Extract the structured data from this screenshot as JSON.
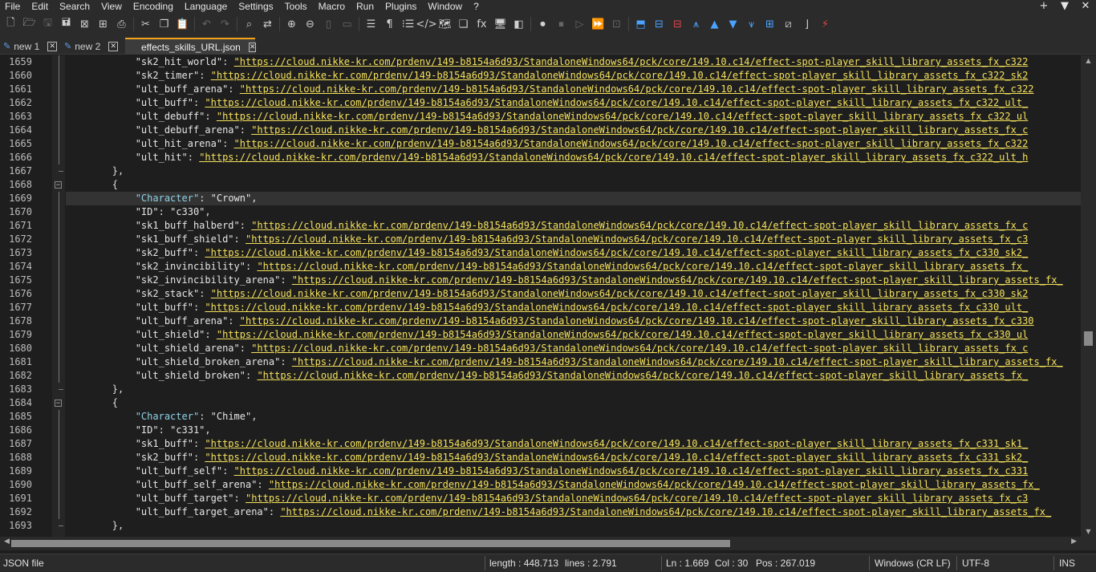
{
  "menu": {
    "items": [
      "File",
      "Edit",
      "Search",
      "View",
      "Encoding",
      "Language",
      "Settings",
      "Tools",
      "Macro",
      "Run",
      "Plugins",
      "Window",
      "?"
    ],
    "right": [
      "+",
      "▼",
      "✕"
    ]
  },
  "toolbar": {
    "icons": [
      {
        "name": "new-file-icon",
        "glyph": "🗋"
      },
      {
        "name": "open-file-icon",
        "glyph": "🗁"
      },
      {
        "name": "save-icon",
        "glyph": "🖫",
        "dim": true
      },
      {
        "name": "save-all-icon",
        "glyph": "🖬"
      },
      {
        "name": "close-icon",
        "glyph": "⊠"
      },
      {
        "name": "close-all-icon",
        "glyph": "⊞"
      },
      {
        "name": "print-icon",
        "glyph": "⎙"
      },
      {
        "name": "sep"
      },
      {
        "name": "cut-icon",
        "glyph": "✂"
      },
      {
        "name": "copy-icon",
        "glyph": "❐"
      },
      {
        "name": "paste-icon",
        "glyph": "📋"
      },
      {
        "name": "sep"
      },
      {
        "name": "undo-icon",
        "glyph": "↶",
        "dim": true
      },
      {
        "name": "redo-icon",
        "glyph": "↷",
        "dim": true
      },
      {
        "name": "sep"
      },
      {
        "name": "find-icon",
        "glyph": "⌕"
      },
      {
        "name": "replace-icon",
        "glyph": "⇄"
      },
      {
        "name": "sep"
      },
      {
        "name": "zoom-in-icon",
        "glyph": "⊕"
      },
      {
        "name": "zoom-out-icon",
        "glyph": "⊖"
      },
      {
        "name": "sync-vertical-icon",
        "glyph": "▯",
        "dim": true
      },
      {
        "name": "sync-horizontal-icon",
        "glyph": "▭",
        "dim": true
      },
      {
        "name": "sep"
      },
      {
        "name": "word-wrap-icon",
        "glyph": "☰"
      },
      {
        "name": "show-all-chars-icon",
        "glyph": "¶"
      },
      {
        "name": "indent-guide-icon",
        "glyph": "⁝☰"
      },
      {
        "name": "xml-icon",
        "glyph": "</>"
      },
      {
        "name": "doc-map-icon",
        "glyph": "🗺"
      },
      {
        "name": "doc-list-icon",
        "glyph": "❏"
      },
      {
        "name": "function-list-icon",
        "glyph": "fx"
      },
      {
        "name": "folder-workspace-icon",
        "glyph": "🖥"
      },
      {
        "name": "monitoring-icon",
        "glyph": "◧"
      },
      {
        "name": "sep"
      },
      {
        "name": "record-macro-icon",
        "glyph": "⏺"
      },
      {
        "name": "stop-macro-icon",
        "glyph": "⏹",
        "dim": true
      },
      {
        "name": "play-macro-icon",
        "glyph": "▷",
        "dim": true
      },
      {
        "name": "run-macro-multiple-icon",
        "glyph": "⏩"
      },
      {
        "name": "save-macro-icon",
        "glyph": "⊡",
        "dim": true
      },
      {
        "name": "sep"
      },
      {
        "name": "plugin-a-icon",
        "glyph": "⬒",
        "blue": true
      },
      {
        "name": "plugin-b-icon",
        "glyph": "⊟",
        "blue": true
      },
      {
        "name": "plugin-c-icon",
        "glyph": "⊟",
        "red": true
      },
      {
        "name": "plugin-d-icon",
        "glyph": "⩚",
        "blue": true
      },
      {
        "name": "move-up-icon",
        "glyph": "▲",
        "blue": true
      },
      {
        "name": "move-down-icon",
        "glyph": "▼",
        "blue": true
      },
      {
        "name": "plugin-e-icon",
        "glyph": "⩛",
        "blue": true
      },
      {
        "name": "plugin-f-icon",
        "glyph": "⊞",
        "blue": true
      },
      {
        "name": "plugin-g-icon",
        "glyph": "⧄"
      },
      {
        "name": "plugin-h-icon",
        "glyph": "⌋"
      },
      {
        "name": "plugin-i-icon",
        "glyph": "⚡",
        "red": true
      }
    ]
  },
  "tabs": [
    {
      "label": "new 1",
      "close": "✕",
      "active": false
    },
    {
      "label": "new 2",
      "close": "✕",
      "active": false
    },
    {
      "label": "effects_skills_URL.json",
      "close": "✕",
      "active": true
    }
  ],
  "url_prefix": "https://cloud.nikke-kr.com/prdenv/149-b8154a6d93/StandaloneWindows64/pck/core/149.10.c14/effect-spot-player_skill_library_assets_fx_",
  "lines": [
    {
      "n": "1659",
      "indent": "            ",
      "key": "sk2_hit_world",
      "suffix": "c322"
    },
    {
      "n": "1660",
      "indent": "            ",
      "key": "sk2_timer",
      "suffix": "c322_sk2"
    },
    {
      "n": "1661",
      "indent": "            ",
      "key": "ult_buff_arena",
      "suffix": "c322"
    },
    {
      "n": "1662",
      "indent": "            ",
      "key": "ult_buff",
      "suffix": "c322_ult_"
    },
    {
      "n": "1663",
      "indent": "            ",
      "key": "ult_debuff",
      "suffix": "c322_ul"
    },
    {
      "n": "1664",
      "indent": "            ",
      "key": "ult_debuff_arena",
      "suffix": "c"
    },
    {
      "n": "1665",
      "indent": "            ",
      "key": "ult_hit_arena",
      "suffix": "c322"
    },
    {
      "n": "1666",
      "indent": "            ",
      "key": "ult_hit",
      "suffix": "c322_ult_h"
    },
    {
      "n": "1667",
      "indent": "        ",
      "text": "},"
    },
    {
      "n": "1668",
      "indent": "        ",
      "text": "{"
    },
    {
      "n": "1669",
      "indent": "            ",
      "key": "Character",
      "value": "Crown",
      "ch": true,
      "current": true
    },
    {
      "n": "1670",
      "indent": "            ",
      "key": "ID",
      "value": "c330"
    },
    {
      "n": "1671",
      "indent": "            ",
      "key": "sk1_buff_halberd",
      "suffix": "c"
    },
    {
      "n": "1672",
      "indent": "            ",
      "key": "sk1_buff_shield",
      "suffix": "c3"
    },
    {
      "n": "1673",
      "indent": "            ",
      "key": "sk2_buff",
      "suffix": "c330_sk2_"
    },
    {
      "n": "1674",
      "indent": "            ",
      "key": "sk2_invincibility",
      "suffix": ""
    },
    {
      "n": "1675",
      "indent": "            ",
      "key": "sk2_invincibility_arena",
      "suffix": ""
    },
    {
      "n": "1676",
      "indent": "            ",
      "key": "sk2_stack",
      "suffix": "c330_sk2"
    },
    {
      "n": "1677",
      "indent": "            ",
      "key": "ult_buff",
      "suffix": "c330_ult_"
    },
    {
      "n": "1678",
      "indent": "            ",
      "key": "ult_buff_arena",
      "suffix": "c330"
    },
    {
      "n": "1679",
      "indent": "            ",
      "key": "ult_shield",
      "suffix": "c330_ul"
    },
    {
      "n": "1680",
      "indent": "            ",
      "key": "ult_shield_arena",
      "suffix": "c"
    },
    {
      "n": "1681",
      "indent": "            ",
      "key": "ult_shield_broken_arena",
      "suffix": ""
    },
    {
      "n": "1682",
      "indent": "            ",
      "key": "ult_shield_broken",
      "suffix": ""
    },
    {
      "n": "1683",
      "indent": "        ",
      "text": "},"
    },
    {
      "n": "1684",
      "indent": "        ",
      "text": "{"
    },
    {
      "n": "1685",
      "indent": "            ",
      "key": "Character",
      "value": "Chime",
      "ch": true
    },
    {
      "n": "1686",
      "indent": "            ",
      "key": "ID",
      "value": "c331"
    },
    {
      "n": "1687",
      "indent": "            ",
      "key": "sk1_buff",
      "suffix": "c331_sk1_"
    },
    {
      "n": "1688",
      "indent": "            ",
      "key": "sk2_buff",
      "suffix": "c331_sk2_"
    },
    {
      "n": "1689",
      "indent": "            ",
      "key": "ult_buff_self",
      "suffix": "c331"
    },
    {
      "n": "1690",
      "indent": "            ",
      "key": "ult_buff_self_arena",
      "suffix": ""
    },
    {
      "n": "1691",
      "indent": "            ",
      "key": "ult_buff_target",
      "suffix": "c3"
    },
    {
      "n": "1692",
      "indent": "            ",
      "key": "ult_buff_target_arena",
      "suffix": ""
    },
    {
      "n": "1693",
      "indent": "        ",
      "text": "},"
    }
  ],
  "status": {
    "file_type": "JSON file",
    "length": "length : 448.713",
    "lines": "lines : 2.791",
    "ln": "Ln : 1.669",
    "col": "Col : 30",
    "pos": "Pos : 267.019",
    "eol": "Windows (CR LF)",
    "encoding": "UTF-8",
    "ins": "INS"
  }
}
